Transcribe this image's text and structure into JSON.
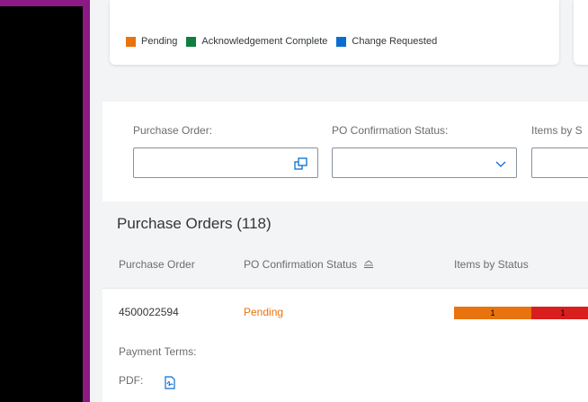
{
  "chart_card": {
    "legend": [
      {
        "label": "Pending",
        "color": "#e9730c"
      },
      {
        "label": "Acknowledgement Complete",
        "color": "#107e3e"
      },
      {
        "label": "Change Requested",
        "color": "#0a6ed1"
      }
    ]
  },
  "filters": {
    "purchase_order_label": "Purchase Order:",
    "purchase_order_value": "",
    "po_status_label": "PO Confirmation Status:",
    "po_status_value": "",
    "items_by_status_label": "Items by S"
  },
  "table": {
    "title": "Purchase Orders (118)",
    "columns": [
      "Purchase Order",
      "PO Confirmation Status",
      "Items by Status"
    ],
    "rows": [
      {
        "purchase_order": "4500022594",
        "status": "Pending",
        "status_color": "#e9730c",
        "items_by_status": [
          {
            "count": "1",
            "color": "#e9730c"
          },
          {
            "count": "1",
            "color": "#d91e1e"
          }
        ],
        "payment_terms_label": "Payment Terms:",
        "pdf_label": "PDF:"
      }
    ]
  }
}
